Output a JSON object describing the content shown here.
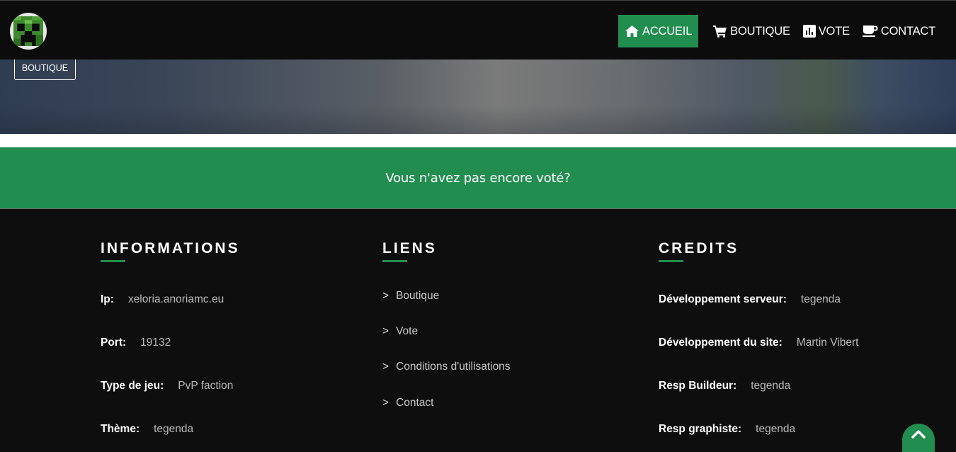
{
  "nav": {
    "items": [
      {
        "label": "ACCUEIL",
        "icon": "home-icon",
        "active": true
      },
      {
        "label": "BOUTIQUE",
        "icon": "cart-icon",
        "active": false
      },
      {
        "label": "VOTE",
        "icon": "chart-icon",
        "active": false
      },
      {
        "label": "CONTACT",
        "icon": "cup-icon",
        "active": false
      }
    ]
  },
  "hero": {
    "button_label": "BOUTIQUE"
  },
  "vote_band": {
    "text": "Vous n'avez pas encore voté?"
  },
  "footer": {
    "informations": {
      "title": "INFORMATIONS",
      "rows": [
        {
          "key": "Ip:",
          "value": "xeloria.anoriamc.eu"
        },
        {
          "key": "Port:",
          "value": "19132"
        },
        {
          "key": "Type de jeu:",
          "value": "PvP faction"
        },
        {
          "key": "Thème:",
          "value": "tegenda"
        }
      ]
    },
    "liens": {
      "title": "LIENS",
      "chevron": ">",
      "links": [
        "Boutique",
        "Vote",
        "Conditions d'utilisations",
        "Contact"
      ]
    },
    "credits": {
      "title": "CREDITS",
      "rows": [
        {
          "key": "Développement serveur:",
          "value": "tegenda"
        },
        {
          "key": "Développement du site:",
          "value": "Martin Vibert"
        },
        {
          "key": "Resp Buildeur:",
          "value": "tegenda"
        },
        {
          "key": "Resp graphiste:",
          "value": "tegenda"
        }
      ]
    }
  },
  "colors": {
    "accent": "#218d4f",
    "navbar": "#0c0c0c",
    "footer": "#0e0e0e"
  }
}
